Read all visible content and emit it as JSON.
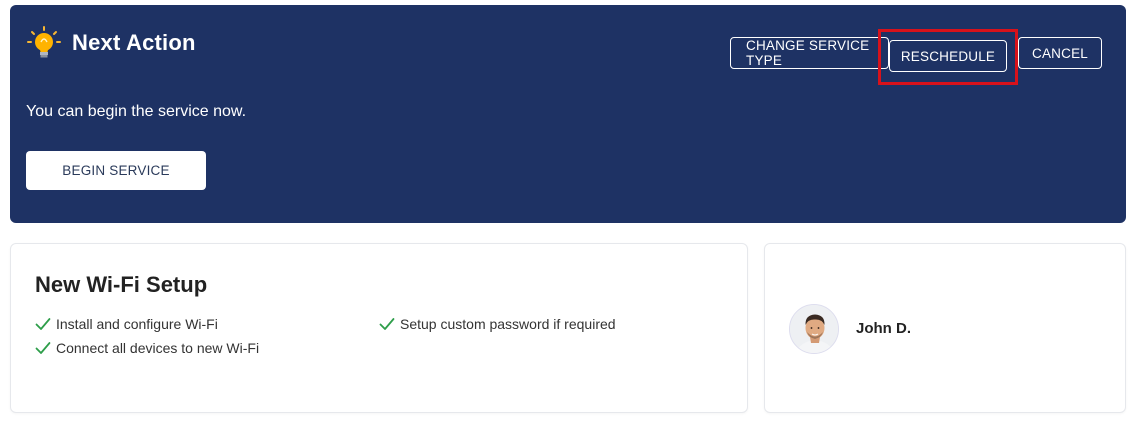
{
  "next_action": {
    "title": "Next Action",
    "status_text": "You can begin the service now.",
    "buttons": {
      "change_service_type": "CHANGE SERVICE TYPE",
      "reschedule": "RESCHEDULE",
      "cancel": "CANCEL",
      "begin_service": "BEGIN SERVICE"
    }
  },
  "service": {
    "title": "New Wi-Fi Setup",
    "tasks": [
      "Install and configure Wi-Fi",
      "Setup custom password if required",
      "Connect all devices to new Wi-Fi"
    ]
  },
  "agent": {
    "name": "John D."
  },
  "colors": {
    "panel_bg": "#1e3264",
    "highlight_border": "#d8121b",
    "check_green": "#2e9e4a"
  },
  "icons": {
    "header": "lightbulb-icon",
    "task": "checkmark-icon",
    "agent": "avatar"
  }
}
